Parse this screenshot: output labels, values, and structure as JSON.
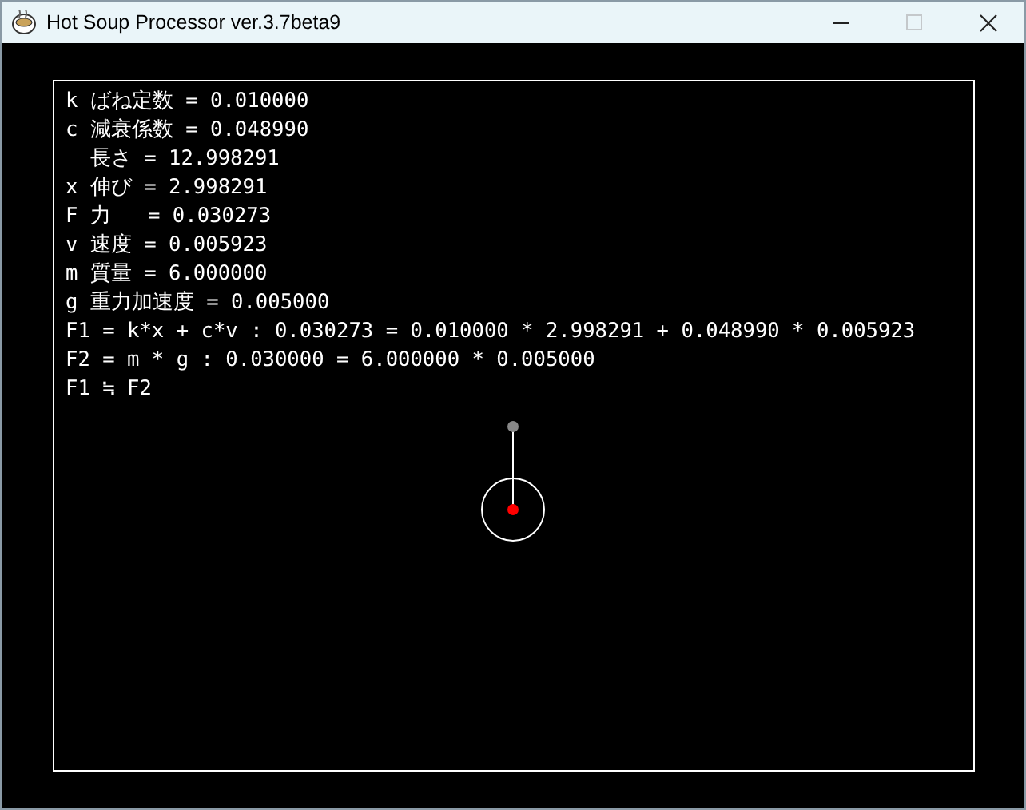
{
  "window": {
    "title": "Hot Soup Processor ver.3.7beta9",
    "controls": [
      {
        "kind": "minimize",
        "disabled": false
      },
      {
        "kind": "maximize",
        "disabled": true
      },
      {
        "kind": "close",
        "disabled": false
      }
    ]
  },
  "lines": [
    "k ばね定数 = 0.010000",
    "c 減衰係数 = 0.048990",
    "  長さ = 12.998291",
    "x 伸び = 2.998291",
    "F 力   = 0.030273",
    "v 速度 = 0.005923",
    "m 質量 = 6.000000",
    "g 重力加速度 = 0.005000",
    "F1 = k*x + c*v : 0.030273 = 0.010000 * 2.998291 + 0.048990 * 0.005923",
    "F2 = m * g : 0.030000 = 6.000000 * 0.005000",
    "F1 ≒ F2"
  ]
}
